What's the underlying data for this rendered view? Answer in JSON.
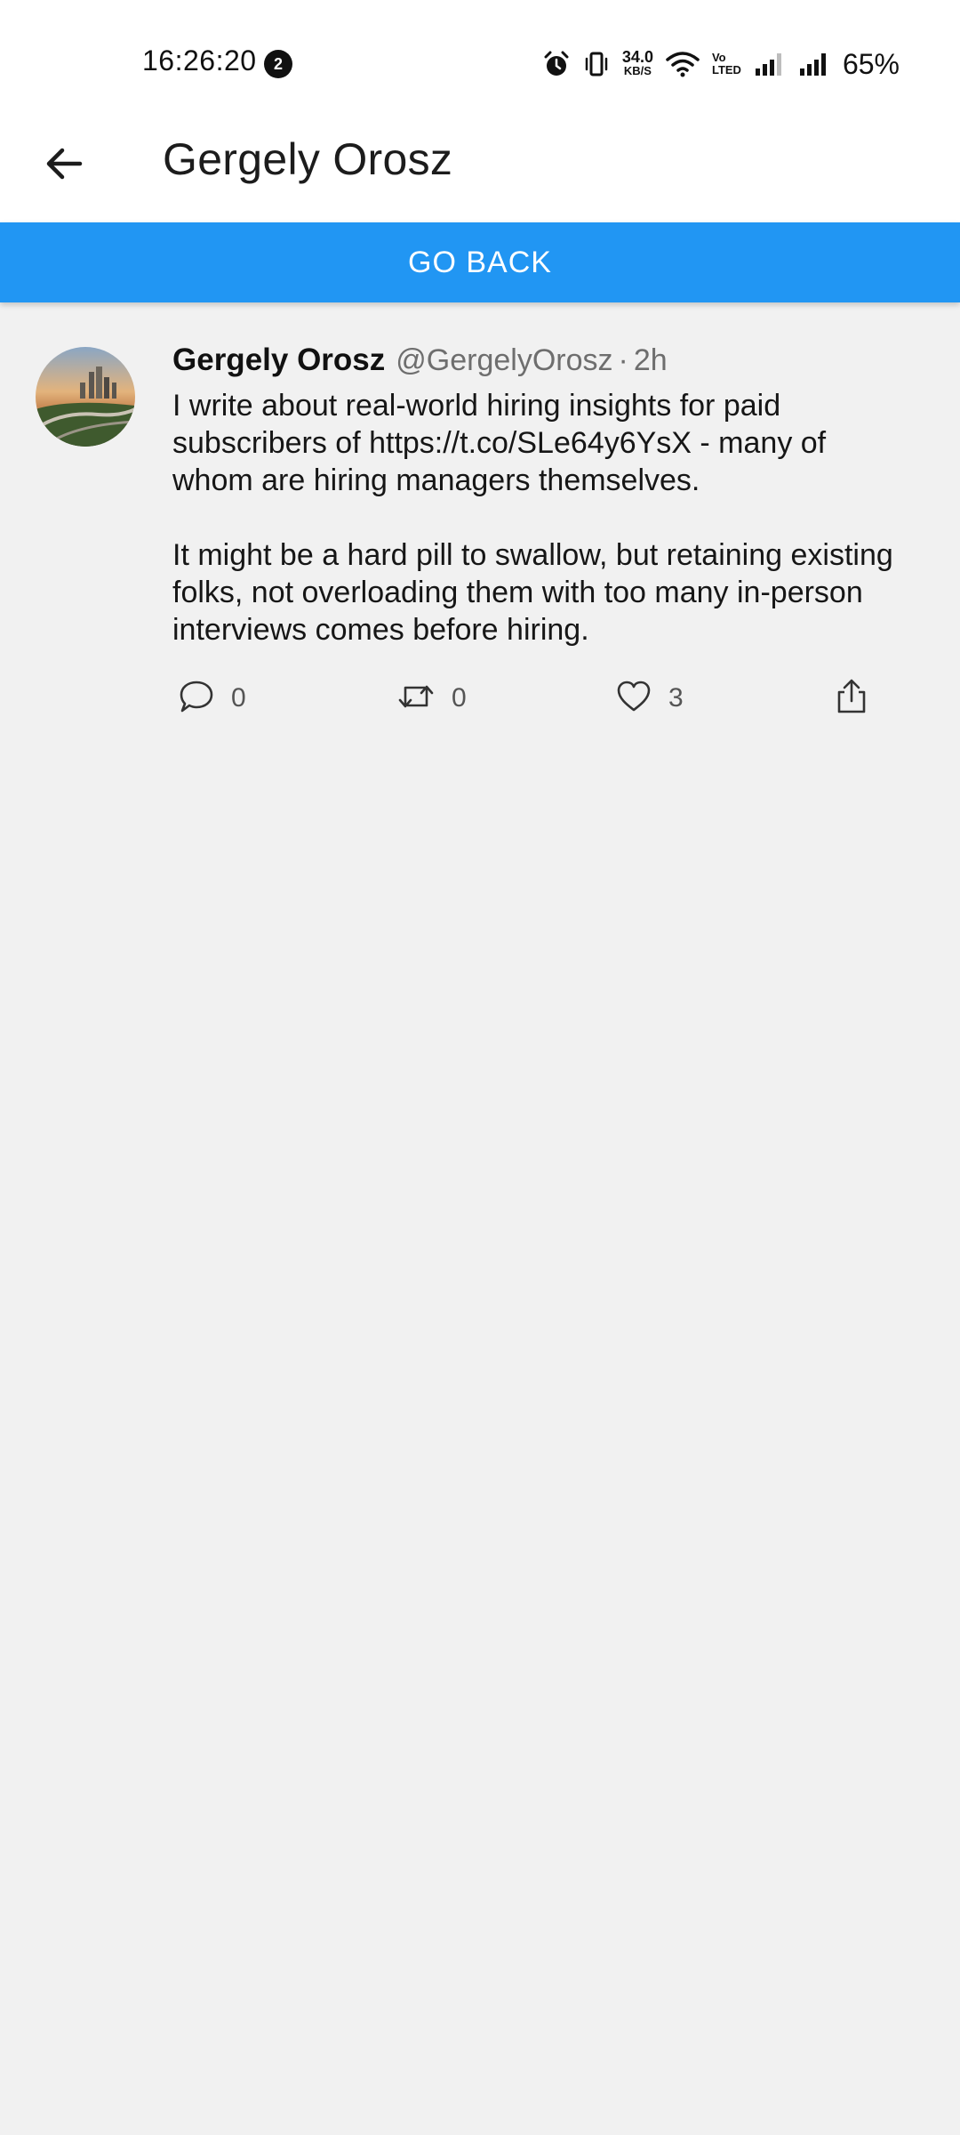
{
  "status_bar": {
    "time": "16:26:20",
    "notification_count": "2",
    "net_speed_value": "34.0",
    "net_speed_unit": "KB/S",
    "volte_top": "Vo",
    "volte_bottom": "LTED",
    "battery": "65%"
  },
  "header": {
    "title": "Gergely Orosz",
    "back_icon": "arrow-left-icon"
  },
  "go_back_label": "GO BACK",
  "tweet": {
    "author_name": "Gergely Orosz",
    "author_handle": "@GergelyOrosz",
    "separator": "·",
    "time": "2h",
    "paragraph_1": "I write about real-world hiring insights for paid subscribers of https://t.co/SLe64y6YsX - many of whom are hiring managers themselves.",
    "paragraph_2": "It might be a hard pill to swallow, but retaining existing folks, not overloading them with too many in-person interviews comes before hiring.",
    "replies": "0",
    "retweets": "0",
    "likes": "3"
  },
  "colors": {
    "accent": "#2196f3",
    "background": "#f1f1f1",
    "secondary_text": "#6e6e6e"
  }
}
